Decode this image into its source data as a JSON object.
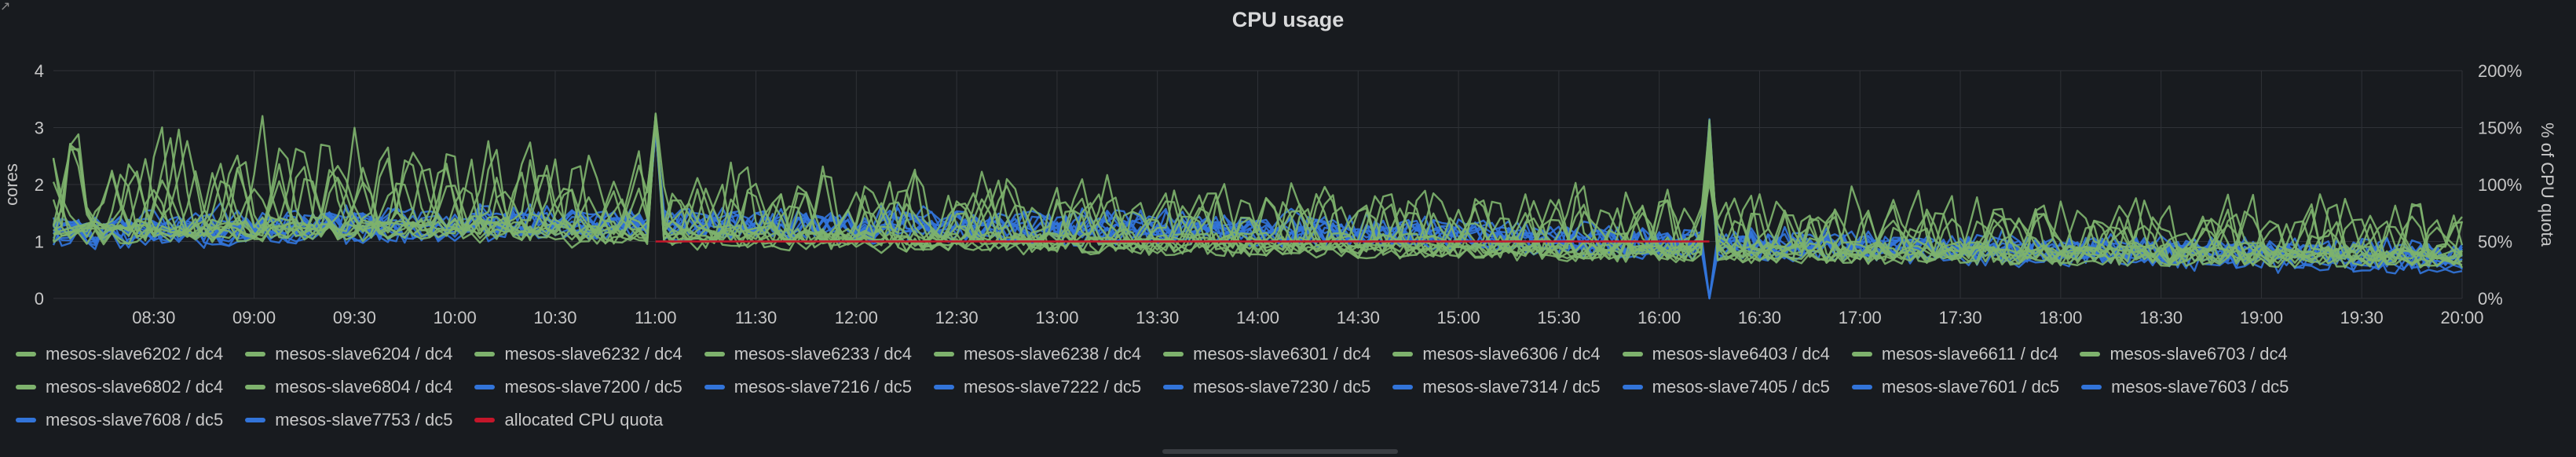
{
  "chart_data": {
    "type": "line",
    "title": "CPU usage",
    "ylabel": "cores",
    "y2label": "% of CPU quota",
    "ylim": [
      0,
      4
    ],
    "y_ticks": [
      "0",
      "1",
      "2",
      "3",
      "4"
    ],
    "y2_ticks": [
      "0%",
      "50%",
      "100%",
      "150%",
      "200%"
    ],
    "y2lim": [
      0,
      2
    ],
    "xlim": [
      "08:00",
      "20:00"
    ],
    "x_ticks": [
      "08:30",
      "09:00",
      "09:30",
      "10:00",
      "10:30",
      "11:00",
      "11:30",
      "12:00",
      "12:30",
      "13:00",
      "13:30",
      "14:00",
      "14:30",
      "15:00",
      "15:30",
      "16:00",
      "16:30",
      "17:00",
      "17:30",
      "18:00",
      "18:30",
      "19:00",
      "19:30",
      "20:00"
    ],
    "grid": true,
    "legend_position": "bottom",
    "series_colors": {
      "dc4": "#7eb26d",
      "dc5": "#3274d9",
      "quota": "#c4162a"
    },
    "series": [
      {
        "name": "mesos-slave6202 / dc4",
        "group": "dc4",
        "baseline": [
          1.2,
          1.3,
          1.2,
          1.0,
          0.85,
          0.75
        ],
        "peak": [
          3.2,
          3.0,
          2.5,
          2.0,
          1.9,
          1.8
        ]
      },
      {
        "name": "mesos-slave6204 / dc4",
        "group": "dc4",
        "baseline": [
          1.15,
          1.2,
          1.1,
          0.95,
          0.8,
          0.7
        ],
        "peak": [
          3.3,
          3.1,
          2.4,
          2.1,
          1.9,
          1.9
        ]
      },
      {
        "name": "mesos-slave6232 / dc4",
        "group": "dc4",
        "baseline": [
          1.1,
          1.25,
          1.15,
          0.9,
          0.8,
          0.7
        ],
        "peak": [
          2.9,
          2.8,
          2.2,
          1.9,
          1.8,
          1.7
        ]
      },
      {
        "name": "mesos-slave6233 / dc4",
        "group": "dc4",
        "baseline": [
          1.2,
          1.3,
          1.1,
          0.95,
          0.85,
          0.75
        ],
        "peak": [
          3.0,
          2.9,
          2.3,
          2.0,
          1.8,
          1.6
        ]
      },
      {
        "name": "mesos-slave6238 / dc4",
        "group": "dc4",
        "baseline": [
          1.1,
          1.2,
          1.1,
          0.9,
          0.8,
          0.7
        ],
        "peak": [
          2.6,
          2.7,
          2.1,
          1.9,
          1.7,
          1.6
        ]
      },
      {
        "name": "mesos-slave6301 / dc4",
        "group": "dc4",
        "baseline": [
          1.25,
          1.3,
          1.2,
          1.0,
          0.9,
          0.8
        ],
        "peak": [
          2.4,
          2.5,
          2.0,
          1.8,
          1.6,
          1.5
        ]
      },
      {
        "name": "mesos-slave6306 / dc4",
        "group": "dc4",
        "baseline": [
          1.15,
          1.2,
          1.05,
          0.9,
          0.8,
          0.7
        ],
        "peak": [
          2.2,
          2.2,
          1.9,
          1.7,
          1.5,
          1.4
        ]
      },
      {
        "name": "mesos-slave6403 / dc4",
        "group": "dc4",
        "baseline": [
          1.1,
          1.15,
          1.0,
          0.9,
          0.8,
          0.7
        ],
        "peak": [
          2.0,
          2.1,
          1.8,
          1.6,
          1.5,
          1.3
        ]
      },
      {
        "name": "mesos-slave6611 / dc4",
        "group": "dc4",
        "baseline": [
          1.2,
          1.25,
          1.1,
          0.95,
          0.85,
          0.75
        ],
        "peak": [
          2.3,
          2.4,
          1.9,
          1.7,
          1.6,
          1.4
        ]
      },
      {
        "name": "mesos-slave6703 / dc4",
        "group": "dc4",
        "baseline": [
          1.15,
          1.2,
          1.1,
          0.9,
          0.8,
          0.7
        ],
        "peak": [
          2.1,
          2.2,
          1.8,
          1.6,
          1.5,
          1.3
        ]
      },
      {
        "name": "mesos-slave6802 / dc4",
        "group": "dc4",
        "baseline": [
          1.2,
          1.3,
          1.15,
          1.0,
          0.85,
          0.75
        ],
        "peak": [
          2.5,
          2.6,
          2.0,
          1.8,
          1.7,
          1.5
        ]
      },
      {
        "name": "mesos-slave6804 / dc4",
        "group": "dc4",
        "baseline": [
          1.1,
          1.2,
          1.05,
          0.9,
          0.8,
          0.7
        ],
        "peak": [
          2.2,
          2.3,
          1.9,
          1.7,
          1.5,
          1.4
        ]
      },
      {
        "name": "mesos-slave7200 / dc5",
        "group": "dc5",
        "baseline": [
          1.2,
          1.3,
          1.4,
          1.3,
          1.0,
          0.75
        ],
        "peak": [
          1.6,
          1.8,
          1.7,
          1.6,
          1.3,
          1.0
        ]
      },
      {
        "name": "mesos-slave7216 / dc5",
        "group": "dc5",
        "baseline": [
          1.1,
          1.25,
          1.3,
          1.2,
          0.95,
          0.7
        ],
        "peak": [
          1.5,
          1.7,
          1.6,
          1.5,
          1.2,
          1.0
        ]
      },
      {
        "name": "mesos-slave7222 / dc5",
        "group": "dc5",
        "baseline": [
          1.15,
          1.3,
          1.35,
          1.25,
          1.0,
          0.7
        ],
        "peak": [
          1.5,
          1.7,
          1.6,
          1.5,
          1.2,
          0.9
        ]
      },
      {
        "name": "mesos-slave7230 / dc5",
        "group": "dc5",
        "baseline": [
          1.05,
          1.2,
          1.2,
          1.1,
          0.9,
          0.65
        ],
        "peak": [
          1.4,
          1.6,
          1.5,
          1.4,
          1.1,
          0.9
        ]
      },
      {
        "name": "mesos-slave7314 / dc5",
        "group": "dc5",
        "baseline": [
          1.2,
          1.35,
          1.3,
          1.2,
          0.95,
          0.7
        ],
        "peak": [
          1.6,
          1.8,
          1.6,
          1.5,
          1.2,
          1.0
        ]
      },
      {
        "name": "mesos-slave7405 / dc5",
        "group": "dc5",
        "baseline": [
          1.1,
          1.2,
          1.25,
          1.15,
          0.9,
          0.65
        ],
        "peak": [
          1.5,
          1.6,
          1.5,
          1.4,
          1.1,
          0.9
        ]
      },
      {
        "name": "mesos-slave7601 / dc5",
        "group": "dc5",
        "baseline": [
          1.15,
          1.3,
          1.3,
          1.2,
          0.95,
          0.7
        ],
        "peak": [
          1.5,
          1.7,
          1.6,
          1.5,
          1.2,
          1.0
        ]
      },
      {
        "name": "mesos-slave7603 / dc5",
        "group": "dc5",
        "baseline": [
          1.05,
          1.2,
          1.2,
          1.1,
          0.9,
          0.6
        ],
        "peak": [
          1.4,
          1.6,
          1.5,
          1.4,
          1.1,
          0.9
        ]
      },
      {
        "name": "mesos-slave7608 / dc5",
        "group": "dc5",
        "baseline": [
          1.2,
          1.3,
          1.35,
          1.25,
          1.0,
          0.7
        ],
        "peak": [
          1.6,
          1.8,
          1.7,
          1.5,
          1.2,
          1.0
        ]
      },
      {
        "name": "mesos-slave7753 / dc5",
        "group": "dc5",
        "baseline": [
          1.1,
          1.25,
          1.3,
          1.2,
          0.95,
          0.7
        ],
        "peak": [
          1.5,
          1.7,
          1.6,
          1.5,
          1.2,
          0.9
        ]
      }
    ],
    "baseline_times": [
      "08:00",
      "10:00",
      "11:00",
      "14:00",
      "16:00",
      "20:00"
    ],
    "quota": {
      "name": "allocated CPU quota",
      "y": 1.0,
      "x_start": "11:00",
      "x_end": "16:15"
    },
    "events": [
      {
        "x": "11:00",
        "y_peak": 3.45
      },
      {
        "x": "16:15",
        "y_peak": 3.15,
        "y_dip": 0.0
      }
    ]
  }
}
